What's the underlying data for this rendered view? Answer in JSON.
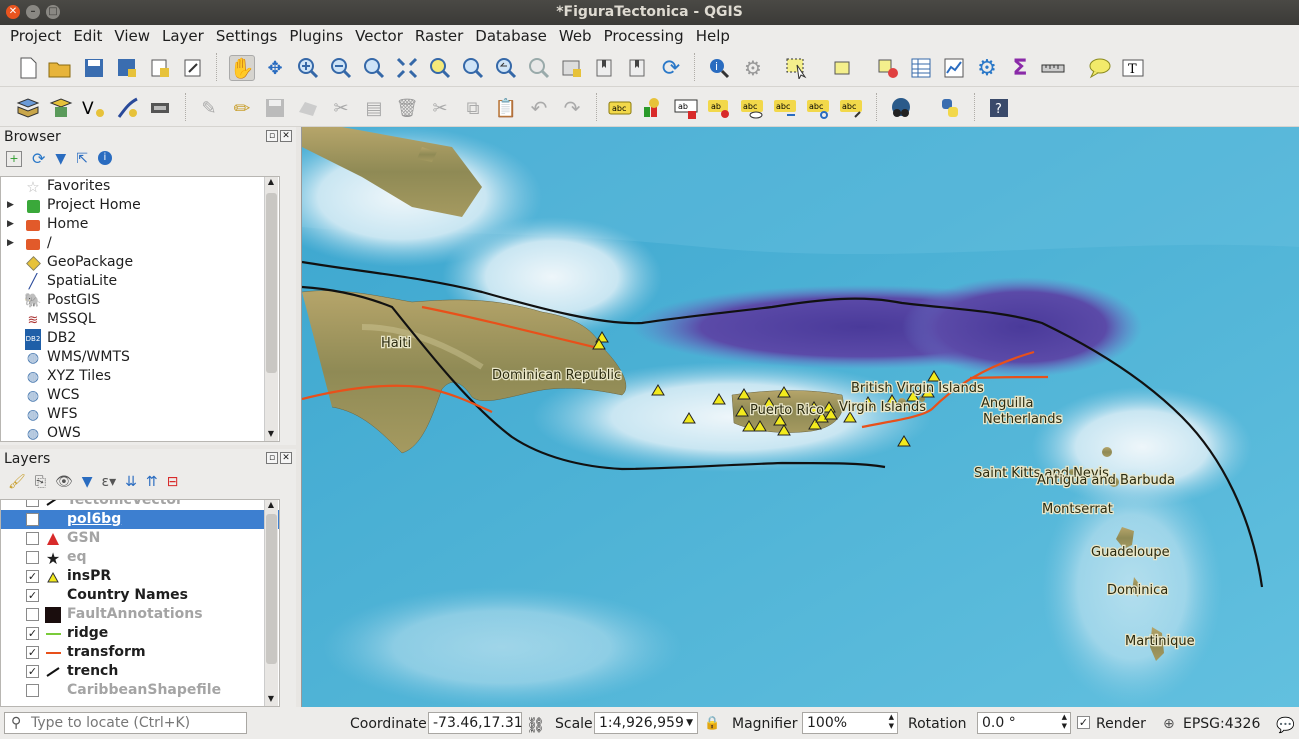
{
  "window": {
    "title": "*FiguraTectonica - QGIS"
  },
  "menubar": {
    "items": [
      "Project",
      "Edit",
      "View",
      "Layer",
      "Settings",
      "Plugins",
      "Vector",
      "Raster",
      "Database",
      "Web",
      "Processing",
      "Help"
    ]
  },
  "browser": {
    "title": "Browser",
    "items": [
      {
        "label": "Favorites",
        "icon": "star-icon",
        "expandable": false
      },
      {
        "label": "Project Home",
        "icon": "project-home-icon",
        "expandable": true
      },
      {
        "label": "Home",
        "icon": "folder-icon",
        "expandable": true
      },
      {
        "label": "/",
        "icon": "folder-icon",
        "expandable": true
      },
      {
        "label": "GeoPackage",
        "icon": "geopackage-icon",
        "expandable": false
      },
      {
        "label": "SpatiaLite",
        "icon": "spatialite-icon",
        "expandable": false
      },
      {
        "label": "PostGIS",
        "icon": "postgis-icon",
        "expandable": false
      },
      {
        "label": "MSSQL",
        "icon": "mssql-icon",
        "expandable": false
      },
      {
        "label": "DB2",
        "icon": "db2-icon",
        "expandable": false
      },
      {
        "label": "WMS/WMTS",
        "icon": "globe-icon",
        "expandable": false
      },
      {
        "label": "XYZ Tiles",
        "icon": "globe-icon",
        "expandable": false
      },
      {
        "label": "WCS",
        "icon": "globe-icon",
        "expandable": false
      },
      {
        "label": "WFS",
        "icon": "globe-icon",
        "expandable": false
      },
      {
        "label": "OWS",
        "icon": "globe-icon",
        "expandable": false
      }
    ]
  },
  "layers": {
    "title": "Layers",
    "items": [
      {
        "name": "TectonicVector",
        "checked": false,
        "symbol": "line-black",
        "selected": false
      },
      {
        "name": "pol6bg",
        "checked": false,
        "symbol": "none",
        "selected": true
      },
      {
        "name": "GSN",
        "checked": false,
        "symbol": "triangle-red",
        "selected": false
      },
      {
        "name": "eq",
        "checked": false,
        "symbol": "star-black",
        "selected": false
      },
      {
        "name": "insPR",
        "checked": true,
        "symbol": "triangle-yellow",
        "selected": false
      },
      {
        "name": "Country Names",
        "checked": true,
        "symbol": "none",
        "selected": false
      },
      {
        "name": "FaultAnnotations",
        "checked": false,
        "symbol": "square-black",
        "selected": false
      },
      {
        "name": "ridge",
        "checked": true,
        "symbol": "line-green",
        "selected": false
      },
      {
        "name": "transform",
        "checked": true,
        "symbol": "line-orange",
        "selected": false
      },
      {
        "name": "trench",
        "checked": true,
        "symbol": "line-black",
        "selected": false
      },
      {
        "name": "CaribbeanShapefile",
        "checked": false,
        "symbol": "none",
        "selected": false
      }
    ]
  },
  "map": {
    "labels": [
      {
        "text": "Haiti"
      },
      {
        "text": "Dominican Republic"
      },
      {
        "text": "Puerto Rico"
      },
      {
        "text": "British Virgin Islands"
      },
      {
        "text": "Virgin Islands"
      },
      {
        "text": "Anguilla"
      },
      {
        "text": "Netherlands"
      },
      {
        "text": "Saint Kitts and Nevis"
      },
      {
        "text": "Antigua and Barbuda"
      },
      {
        "text": "Montserrat"
      },
      {
        "text": "Guadeloupe"
      },
      {
        "text": "Dominica"
      },
      {
        "text": "Martinique"
      }
    ],
    "colors": {
      "transform": "#e8501a",
      "trench": "#111111",
      "triangle": "#f2ea1d",
      "deep": "#5b4aa8",
      "ocean": "#4fb3d6"
    }
  },
  "statusbar": {
    "locator_placeholder": "Type to locate (Ctrl+K)",
    "coordinate_label": "Coordinate",
    "coordinate_value": "-73.46,17.31",
    "scale_label": "Scale",
    "scale_value": "1:4,926,959",
    "magnifier_label": "Magnifier",
    "magnifier_value": "100%",
    "rotation_label": "Rotation",
    "rotation_value": "0.0 °",
    "render_label": "Render",
    "render_checked": true,
    "crs": "EPSG:4326"
  }
}
